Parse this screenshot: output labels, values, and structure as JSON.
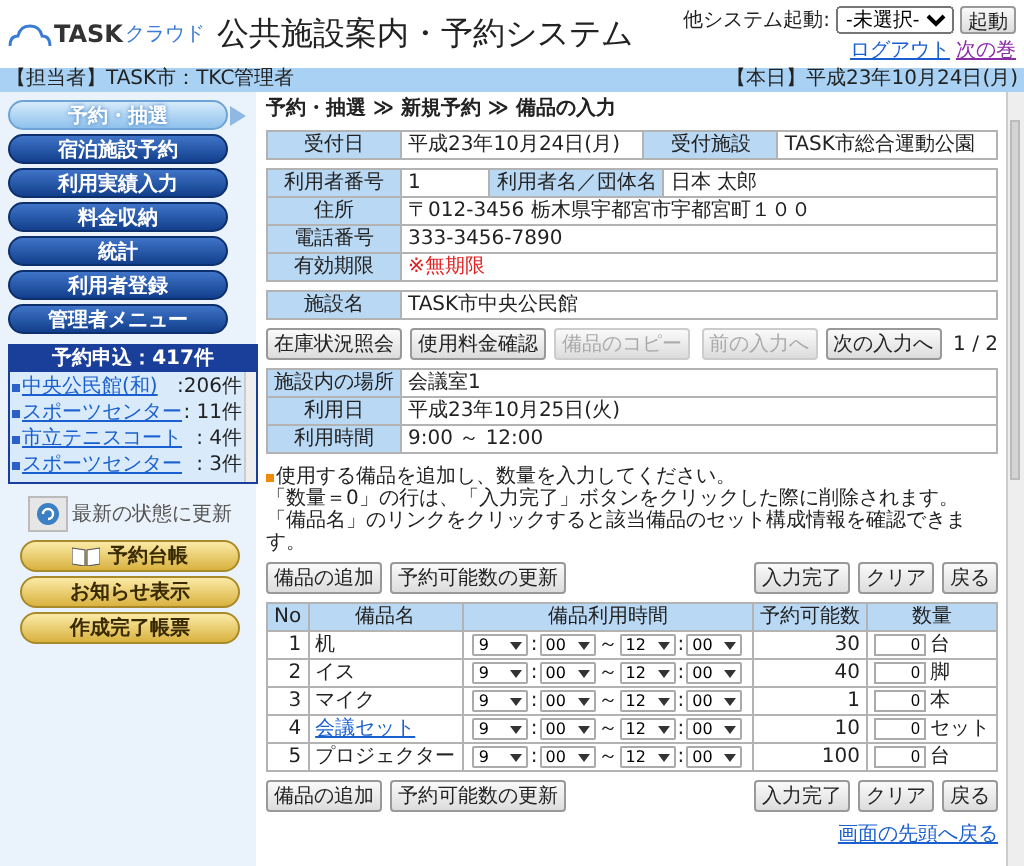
{
  "header": {
    "logo": {
      "brand": "TASK",
      "sub": "クラウド"
    },
    "title": "公共施設案内・予約システム",
    "launcher_label": "他システム起動:",
    "launcher_value": "-未選択-",
    "launch_button": "起動",
    "links": [
      {
        "label": "ログアウト",
        "visited": false
      },
      {
        "label": "次の巻",
        "visited": true
      }
    ]
  },
  "info_bar": {
    "operator": "【担当者】TASK市：TKC管理者",
    "today": "【本日】平成23年10月24日(月)"
  },
  "sidebar": {
    "nav": [
      {
        "label": "予約・抽選",
        "selected": true
      },
      {
        "label": "宿泊施設予約",
        "selected": false
      },
      {
        "label": "利用実績入力",
        "selected": false
      },
      {
        "label": "料金収納",
        "selected": false
      },
      {
        "label": "統計",
        "selected": false
      },
      {
        "label": "利用者登録",
        "selected": false
      },
      {
        "label": "管理者メニュー",
        "selected": false
      }
    ],
    "requests": {
      "title": "予約申込：417件",
      "items": [
        {
          "name": "中央公民館(和)",
          "count": ":206件"
        },
        {
          "name": "スポーツセンター",
          "count": ": 11件"
        },
        {
          "name": "市立テニスコート",
          "count": ": 4件"
        },
        {
          "name": "スポーツセンター",
          "count": ": 3件"
        }
      ]
    },
    "refresh": "最新の状態に更新",
    "shortcuts": [
      {
        "label": "予約台帳",
        "kind": "book"
      },
      {
        "label": "お知らせ表示",
        "kind": "plain"
      },
      {
        "label": "作成完了帳票",
        "kind": "plain"
      }
    ]
  },
  "breadcrumb": "予約・抽選 ≫ 新規予約 ≫ 備品の入力",
  "reception": [
    {
      "label": "受付日",
      "value": "平成23年10月24日(月)"
    },
    {
      "label": "受付施設",
      "value": "TASK市総合運動公園"
    }
  ],
  "user": {
    "number_label": "利用者番号",
    "number": "1",
    "name_label": "利用者名／団体名",
    "name": "日本 太郎",
    "rows": [
      {
        "label": "住所",
        "value": "〒012-3456 栃木県宇都宮市宇都宮町１００",
        "warning": false
      },
      {
        "label": "電話番号",
        "value": "333-3456-7890",
        "warning": false
      },
      {
        "label": "有効期限",
        "value": "※無期限",
        "warning": true
      }
    ]
  },
  "facility": {
    "label": "施設名",
    "value": "TASK市中央公民館"
  },
  "nav_left": [
    {
      "label": "在庫状況照会",
      "disabled": false
    },
    {
      "label": "使用料金確認",
      "disabled": false
    },
    {
      "label": "備品のコピー",
      "disabled": true
    }
  ],
  "nav_right": [
    {
      "label": "前の入力へ",
      "disabled": true
    },
    {
      "label": "次の入力へ",
      "disabled": false
    }
  ],
  "page": "1 / 2",
  "place": [
    {
      "label": "施設内の場所",
      "value": "会議室1"
    },
    {
      "label": "利用日",
      "value": "平成23年10月25日(火)"
    },
    {
      "label": "利用時間",
      "value": "9:00 ～ 12:00"
    }
  ],
  "notes": [
    "使用する備品を追加し、数量を入力してください。",
    "「数量＝0」の行は、「入力完了」ボタンをクリックした際に削除されます。",
    "「備品名」のリンクをクリックすると該当備品のセット構成情報を確認できます。"
  ],
  "actions_left": [
    "備品の追加",
    "予約可能数の更新"
  ],
  "actions_right": [
    "入力完了",
    "クリア",
    "戻る"
  ],
  "table": {
    "columns": [
      "No",
      "備品名",
      "備品利用時間",
      "予約可能数",
      "数量"
    ],
    "rows": [
      {
        "no": "1",
        "name": "机",
        "link": false,
        "time": [
          "9",
          ":",
          "00",
          "～",
          "12",
          ":",
          "00"
        ],
        "available": "30",
        "quantity": "0",
        "unit": "台"
      },
      {
        "no": "2",
        "name": "イス",
        "link": false,
        "time": [
          "9",
          ":",
          "00",
          "～",
          "12",
          ":",
          "00"
        ],
        "available": "40",
        "quantity": "0",
        "unit": "脚"
      },
      {
        "no": "3",
        "name": "マイク",
        "link": false,
        "time": [
          "9",
          ":",
          "00",
          "～",
          "12",
          ":",
          "00"
        ],
        "available": "1",
        "quantity": "0",
        "unit": "本"
      },
      {
        "no": "4",
        "name": "会議セット",
        "link": true,
        "time": [
          "9",
          ":",
          "00",
          "～",
          "12",
          ":",
          "00"
        ],
        "available": "10",
        "quantity": "0",
        "unit": "セット"
      },
      {
        "no": "5",
        "name": "プロジェクター",
        "link": false,
        "time": [
          "9",
          ":",
          "00",
          "～",
          "12",
          ":",
          "00"
        ],
        "available": "100",
        "quantity": "0",
        "unit": "台"
      }
    ]
  },
  "bottom_actions_left": [
    "備品の追加",
    "予約可能数の更新"
  ],
  "bottom_actions_right": [
    "入力完了",
    "クリア",
    "戻る"
  ],
  "top_link": "画面の先頭へ戻る"
}
